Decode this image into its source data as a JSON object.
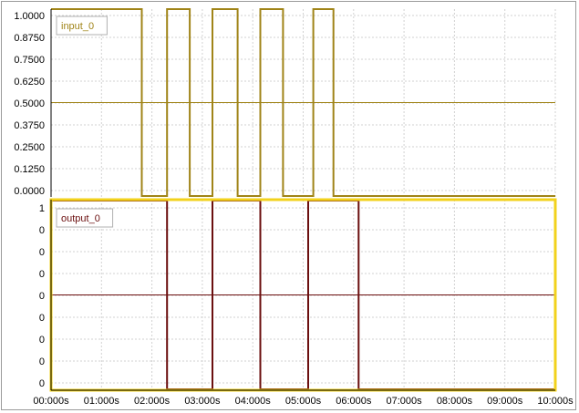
{
  "chart_data": [
    {
      "type": "line",
      "step": true,
      "series": [
        {
          "name": "input_0",
          "color": "#a08418",
          "x": [
            0,
            1.8,
            1.8,
            2.3,
            2.3,
            2.75,
            2.75,
            3.2,
            3.2,
            3.7,
            3.7,
            4.15,
            4.15,
            4.6,
            4.6,
            5.2,
            5.2,
            5.6,
            5.6,
            10
          ],
          "values": [
            1,
            1,
            0,
            0,
            1,
            1,
            0,
            0,
            1,
            1,
            0,
            0,
            1,
            1,
            0,
            0,
            1,
            1,
            0,
            0
          ]
        }
      ],
      "ylim": [
        0,
        1
      ],
      "y_ticks": [
        "1.0000",
        "0.8750",
        "0.7500",
        "0.6250",
        "0.5000",
        "0.3750",
        "0.2500",
        "0.1250",
        "0.0000"
      ],
      "grid": true,
      "legend_position": "top-left",
      "midline_value": 0.5
    },
    {
      "type": "line",
      "step": true,
      "series": [
        {
          "name": "output_0",
          "color": "#6b0f0f",
          "x": [
            0,
            2.3,
            2.3,
            3.2,
            3.2,
            4.15,
            4.15,
            5.1,
            5.1,
            6.1,
            6.1,
            10
          ],
          "values": [
            1,
            1,
            0,
            0,
            1,
            1,
            0,
            0,
            1,
            1,
            0,
            0
          ]
        }
      ],
      "ylim": [
        0,
        1
      ],
      "y_ticks": [
        "1",
        "0",
        "0",
        "0",
        "0",
        "0",
        "0",
        "0",
        "0"
      ],
      "grid": true,
      "legend_position": "top-left",
      "midline_value": 0.5
    }
  ],
  "x_axis": {
    "xlim": [
      0,
      10
    ],
    "ticks": [
      "00:000s",
      "01:000s",
      "02:000s",
      "03:000s",
      "04:000s",
      "05:000s",
      "06:000s",
      "07:000s",
      "08:000s",
      "09:000s",
      "10:000s"
    ]
  },
  "colors": {
    "grid": "#d2d2d2",
    "axis": "#000000",
    "selected_border": "#f2d21c",
    "border": "#9a9a9a"
  }
}
